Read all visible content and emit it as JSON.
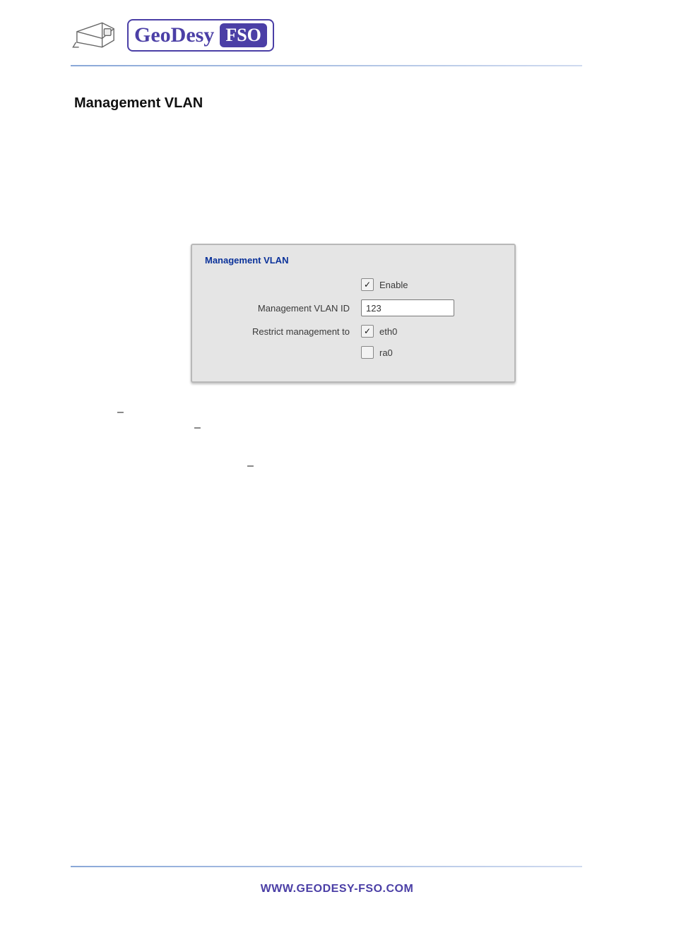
{
  "header": {
    "logo_text_1": "GeoDesy",
    "logo_text_2": "FSO"
  },
  "section": {
    "title": "Management VLAN"
  },
  "panel": {
    "title": "Management VLAN",
    "rows": {
      "enable": {
        "label": "",
        "checkbox_checked": true,
        "checkbox_glyph": "✓",
        "checkbox_label": "Enable"
      },
      "vlan_id": {
        "label": "Management VLAN ID",
        "value": "123"
      },
      "restrict": {
        "label": "Restrict management to",
        "eth0": {
          "checked": true,
          "glyph": "✓",
          "label": "eth0"
        },
        "ra0": {
          "checked": false,
          "glyph": "",
          "label": "ra0"
        }
      }
    }
  },
  "body_symbols": {
    "dash1": "–",
    "dash2": "–",
    "dash3": "–"
  },
  "footer": {
    "url": "WWW.GEODESY-FSO.COM"
  }
}
